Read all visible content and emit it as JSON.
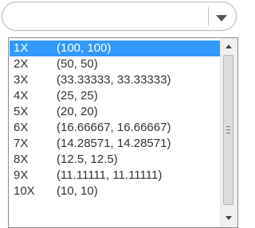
{
  "combo": {
    "value": "",
    "arrow_icon": "chevron-down-icon"
  },
  "dropdown": {
    "selected_index": 0,
    "options": [
      {
        "factor": "1X",
        "scale": "(100, 100)"
      },
      {
        "factor": "2X",
        "scale": "(50, 50)"
      },
      {
        "factor": "3X",
        "scale": "(33.33333, 33.33333)"
      },
      {
        "factor": "4X",
        "scale": "(25, 25)"
      },
      {
        "factor": "5X",
        "scale": "(20, 20)"
      },
      {
        "factor": "6X",
        "scale": "(16.66667, 16.66667)"
      },
      {
        "factor": "7X",
        "scale": "(14.28571, 14.28571)"
      },
      {
        "factor": "8X",
        "scale": "(12.5, 12.5)"
      },
      {
        "factor": "9X",
        "scale": "(11.11111, 11.11111)"
      },
      {
        "factor": "10X",
        "scale": "(10, 10)"
      }
    ]
  },
  "colors": {
    "selection": "#3399ff",
    "selection_text": "#ffffff",
    "text": "#333333"
  }
}
